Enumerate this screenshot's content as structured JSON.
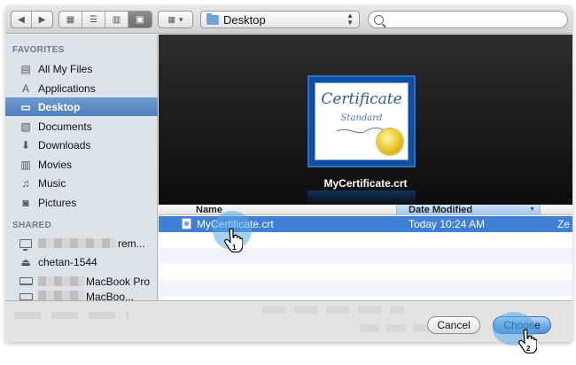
{
  "toolbar": {
    "location": "Desktop"
  },
  "sidebar": {
    "favorites_header": "FAVORITES",
    "favorites": [
      {
        "label": "All My Files",
        "icon": "all-files-icon"
      },
      {
        "label": "Applications",
        "icon": "applications-icon"
      },
      {
        "label": "Desktop",
        "icon": "desktop-icon",
        "selected": true
      },
      {
        "label": "Documents",
        "icon": "documents-icon"
      },
      {
        "label": "Downloads",
        "icon": "downloads-icon"
      },
      {
        "label": "Movies",
        "icon": "movies-icon"
      },
      {
        "label": "Music",
        "icon": "music-icon"
      },
      {
        "label": "Pictures",
        "icon": "pictures-icon"
      }
    ],
    "shared_header": "SHARED",
    "shared": [
      {
        "label": "rem...",
        "icon": "monitor-icon"
      },
      {
        "label": "chetan-1544",
        "icon": "network-disk-icon"
      },
      {
        "label": "MacBook Pro",
        "icon": "laptop-icon"
      },
      {
        "label": "MacBoo...",
        "icon": "laptop-icon"
      }
    ]
  },
  "preview": {
    "certificate_title": "Certificate",
    "certificate_subtitle": "Standard",
    "caption": "MyCertificate.crt"
  },
  "file_list": {
    "columns": {
      "name": "Name",
      "date_modified": "Date Modified"
    },
    "rows": [
      {
        "name": "MyCertificate.crt",
        "date": "Today 10:24 AM",
        "extra": "Ze",
        "selected": true
      }
    ]
  },
  "buttons": {
    "cancel": "Cancel",
    "choose": "Choose"
  },
  "annotations": {
    "step1": "1",
    "step2": "2"
  },
  "colors": {
    "selection": "#3f7fd6",
    "sidebar_selection": "#4f80bd",
    "choose_button": "#6aa8e8"
  }
}
